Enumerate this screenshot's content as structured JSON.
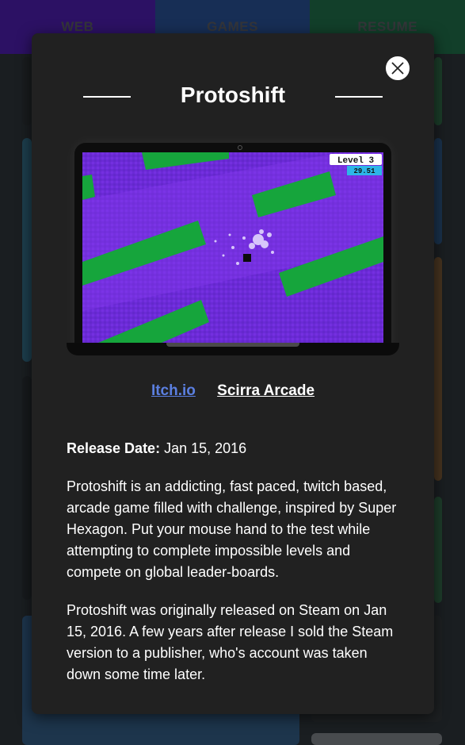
{
  "nav": {
    "tabs": [
      {
        "label": "WEB"
      },
      {
        "label": "GAMES"
      },
      {
        "label": "RESUME"
      }
    ]
  },
  "modal": {
    "title": "Protoshift",
    "close_icon": "close-icon",
    "preview": {
      "level_label": "Level 3",
      "timer": "29.51"
    },
    "links": {
      "itch": "Itch.io",
      "scirra": "Scirra Arcade"
    },
    "release_label": "Release Date:",
    "release_value": "Jan 15, 2016",
    "paragraphs": [
      "Protoshift is an addicting, fast paced, twitch based, arcade game filled with challenge, inspired by Super Hexagon. Put your mouse hand to the test while attempting to complete impossible levels and compete on global leader-boards.",
      "Protoshift was originally released on Steam on Jan 15, 2016. A few years after release I sold the Steam version to a publisher, who's account was taken down some time later."
    ]
  },
  "colors": {
    "tab_web": "#6a1cff",
    "tab_games": "#2f6cd6",
    "tab_resume": "#1f9a5c",
    "modal_bg": "#212121",
    "link_itch": "#5b7fe0",
    "game_purple": "#6f2bd8",
    "game_green": "#16a53c"
  }
}
